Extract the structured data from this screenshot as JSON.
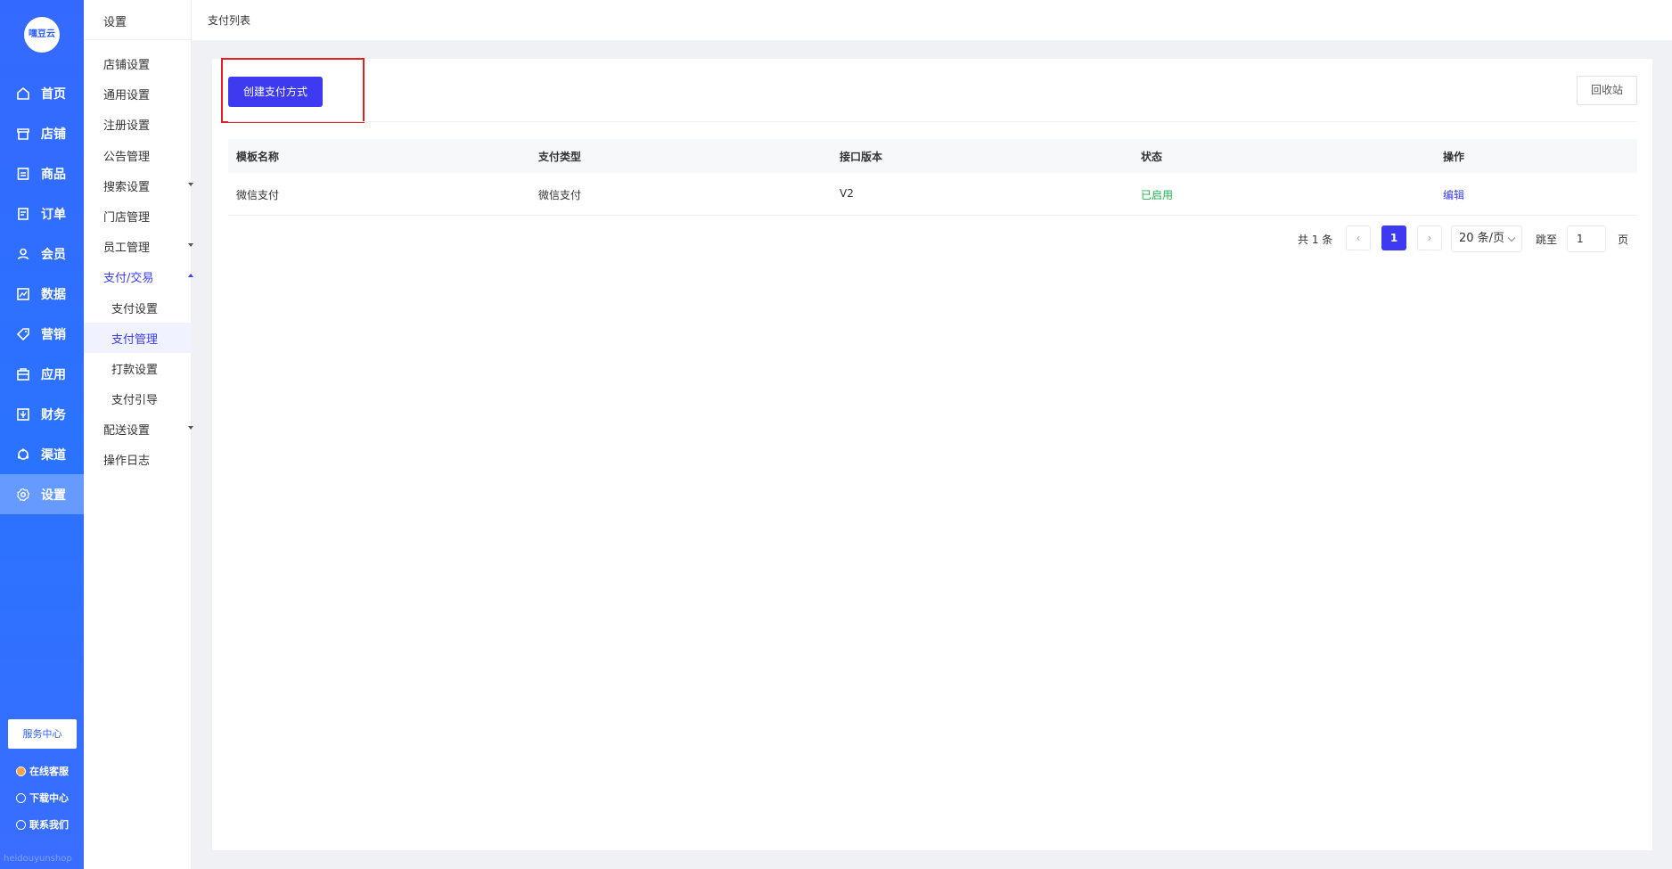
{
  "logo": {
    "text": "嘿豆云"
  },
  "nav": {
    "items": [
      {
        "label": "首页",
        "icon": "home-icon"
      },
      {
        "label": "店铺",
        "icon": "store-icon"
      },
      {
        "label": "商品",
        "icon": "goods-icon"
      },
      {
        "label": "订单",
        "icon": "order-icon"
      },
      {
        "label": "会员",
        "icon": "user-icon"
      },
      {
        "label": "数据",
        "icon": "chart-icon"
      },
      {
        "label": "营销",
        "icon": "tag-icon"
      },
      {
        "label": "应用",
        "icon": "app-icon"
      },
      {
        "label": "财务",
        "icon": "finance-icon"
      },
      {
        "label": "渠道",
        "icon": "channel-icon"
      },
      {
        "label": "设置",
        "icon": "gear-icon",
        "active": true
      }
    ],
    "service_center": "服务中心",
    "links": [
      "在线客服",
      "下载中心",
      "联系我们"
    ],
    "watermark": "heidouyunshop"
  },
  "subnav": {
    "title": "设置",
    "items": [
      {
        "label": "店铺设置"
      },
      {
        "label": "通用设置"
      },
      {
        "label": "注册设置"
      },
      {
        "label": "公告管理"
      },
      {
        "label": "搜索设置",
        "expandable": true
      },
      {
        "label": "门店管理"
      },
      {
        "label": "员工管理",
        "expandable": true
      },
      {
        "label": "支付/交易",
        "expandable": true,
        "open": true
      },
      {
        "label": "配送设置",
        "expandable": true
      },
      {
        "label": "操作日志"
      }
    ],
    "children": [
      {
        "label": "支付设置"
      },
      {
        "label": "支付管理",
        "active": true
      },
      {
        "label": "打款设置"
      },
      {
        "label": "支付引导"
      }
    ]
  },
  "breadcrumb": "支付列表",
  "toolbar": {
    "create_label": "创建支付方式",
    "recycle_label": "回收站"
  },
  "table": {
    "headers": [
      "模板名称",
      "支付类型",
      "接口版本",
      "状态",
      "操作"
    ],
    "rows": [
      {
        "name": "微信支付",
        "type": "微信支付",
        "version": "V2",
        "status": "已启用",
        "action": "编辑"
      }
    ]
  },
  "pagination": {
    "total": "共 1 条",
    "prev": "‹",
    "current": "1",
    "next": "›",
    "page_size": "20 条/页",
    "jump_label": "跳至",
    "jump_value": "1",
    "page_suffix": "页"
  },
  "colors": {
    "accent": "#3d3af1",
    "sidebar": "#2a73ff",
    "status_enabled": "#1bb34a",
    "highlight": "#e62020"
  }
}
